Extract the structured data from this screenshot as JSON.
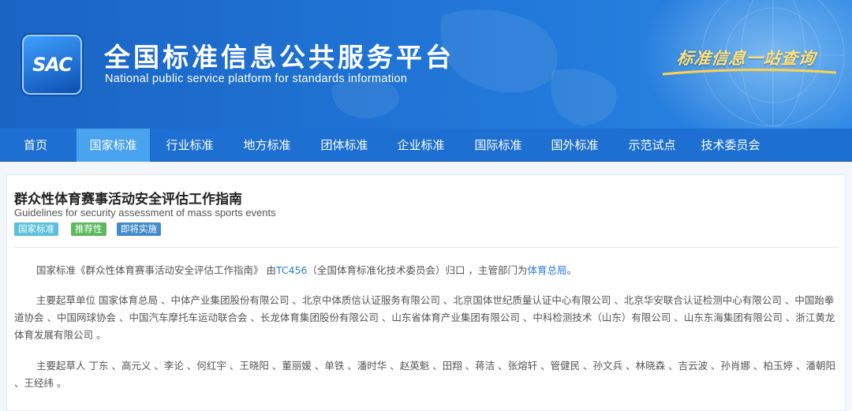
{
  "header": {
    "logo_text": "SAC",
    "title": "全国标准信息公共服务平台",
    "subtitle": "National public service platform  for standards information",
    "slogan": "标准信息一站查询"
  },
  "nav": {
    "items": [
      {
        "label": "首页",
        "active": false
      },
      {
        "label": "国家标准",
        "active": true
      },
      {
        "label": "行业标准",
        "active": false
      },
      {
        "label": "地方标准",
        "active": false
      },
      {
        "label": "团体标准",
        "active": false
      },
      {
        "label": "企业标准",
        "active": false
      },
      {
        "label": "国际标准",
        "active": false
      },
      {
        "label": "国外标准",
        "active": false
      },
      {
        "label": "示范试点",
        "active": false
      },
      {
        "label": "技术委员会",
        "active": false
      }
    ]
  },
  "standard": {
    "title_cn": "群众性体育赛事活动安全评估工作指南",
    "title_en": "Guidelines for security assessment of mass sports events",
    "badges": [
      {
        "label": "国家标准",
        "color": "#5bc0de"
      },
      {
        "label": "推荐性",
        "color": "#5cb85c"
      },
      {
        "label": "即将实施",
        "color": "#428bca"
      }
    ],
    "intro": {
      "prefix": "国家标准《群众性体育赛事活动安全评估工作指南》 由",
      "tc_link": "TC456",
      "middle": "（全国体育标准化技术委员会）归口 ，主管部门为",
      "dept_link": "体育总局",
      "suffix": "。"
    },
    "drafting_units": "主要起草单位 国家体育总局 、中体产业集团股份有限公司 、北京中体质信认证服务有限公司 、北京国体世纪质量认证中心有限公司 、北京华安联合认证检测中心有限公司 、中国跆拳道协会 、中国网球协会 、中国汽车摩托车运动联合会 、长龙体育集团股份有限公司 、山东省体育产业集团有限公司 、中科检测技术（山东）有限公司 、山东东海集团有限公司 、浙江黄龙体育发展有限公司 。",
    "drafters": "主要起草人 丁东 、高元义 、李论 、何红宇 、王晓阳 、董丽媛 、单铁 、潘时华 、赵英魁 、田翔 、蒋洁 、张熔轩 、管健民 、孙文兵 、林晓森 、吉云波 、孙肖娜 、柏玉婷 、潘朝阳 、王经纬 。"
  }
}
